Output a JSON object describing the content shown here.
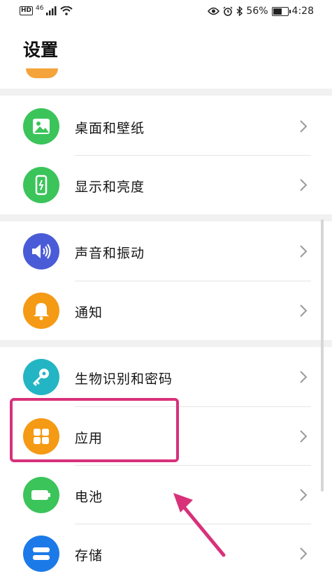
{
  "status_bar": {
    "network": "46",
    "battery_percent": "56%",
    "battery_level": 0.56,
    "time": "4:28"
  },
  "header": {
    "title": "设置"
  },
  "settings_items": [
    {
      "label": "桌面和壁纸",
      "icon": "wallpaper-icon",
      "color": "#3bc45a"
    },
    {
      "label": "显示和亮度",
      "icon": "display-icon",
      "color": "#3bc45a"
    },
    {
      "label": "声音和振动",
      "icon": "sound-icon",
      "color": "#4a5bd8"
    },
    {
      "label": "通知",
      "icon": "bell-icon",
      "color": "#f59a14"
    },
    {
      "label": "生物识别和密码",
      "icon": "key-icon",
      "color": "#24b5c4"
    },
    {
      "label": "应用",
      "icon": "apps-icon",
      "color": "#f59a14"
    },
    {
      "label": "电池",
      "icon": "battery-icon",
      "color": "#3bc45a"
    },
    {
      "label": "存储",
      "icon": "storage-icon",
      "color": "#1c7ae8"
    }
  ],
  "annotation": {
    "highlight_color": "#d8317a"
  }
}
